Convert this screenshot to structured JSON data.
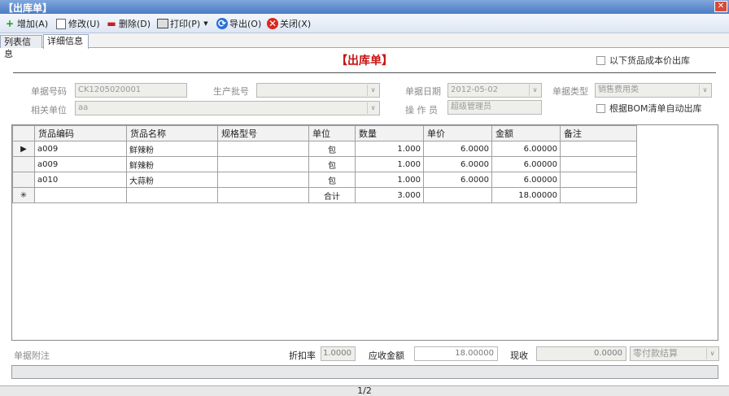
{
  "window": {
    "title": "【出库单】",
    "close_glyph": "✕"
  },
  "toolbar": {
    "add": "增加(A)",
    "edit": "修改(U)",
    "delete": "删除(D)",
    "print": "打印(P)",
    "export": "导出(O)",
    "close": "关闭(X)"
  },
  "tabs": {
    "list": "列表信息",
    "detail": "详细信息"
  },
  "doc": {
    "title": "【出库单】",
    "cost_price_checkbox": "以下货品成本价出库",
    "bom_checkbox": "根据BOM清单自动出库"
  },
  "header": {
    "doc_no_label": "单据号码",
    "doc_no": "CK1205020001",
    "batch_label": "生产批号",
    "batch": "",
    "date_label": "单据日期",
    "date": "2012-05-02",
    "type_label": "单据类型",
    "type": "销售费用类",
    "related_label": "相关单位",
    "related": "aa",
    "operator_label": "操 作 员",
    "operator": "超级管理员"
  },
  "grid": {
    "columns": [
      "货品编码",
      "货品名称",
      "规格型号",
      "单位",
      "数量",
      "单价",
      "金额",
      "备注"
    ],
    "rows": [
      {
        "marker": "▶",
        "code": "a009",
        "name": "鲜辣粉",
        "spec": "",
        "unit": "包",
        "qty": "1.000",
        "price": "6.0000",
        "amount": "6.00000",
        "note": ""
      },
      {
        "marker": "",
        "code": "a009",
        "name": "鲜辣粉",
        "spec": "",
        "unit": "包",
        "qty": "1.000",
        "price": "6.0000",
        "amount": "6.00000",
        "note": ""
      },
      {
        "marker": "",
        "code": "a010",
        "name": "大蒜粉",
        "spec": "",
        "unit": "包",
        "qty": "1.000",
        "price": "6.0000",
        "amount": "6.00000",
        "note": ""
      }
    ],
    "new_row": {
      "marker": "✳",
      "unit": "合计",
      "qty": "3.000",
      "amount": "18.00000"
    }
  },
  "footer": {
    "remark_label": "单据附注",
    "discount_label": "折扣率",
    "discount": "1.0000",
    "receivable_label": "应收金额",
    "receivable": "18.00000",
    "cash_label": "现收",
    "cash": "0.0000",
    "settle": "零付款结算"
  },
  "pager": {
    "text": "1/2"
  }
}
